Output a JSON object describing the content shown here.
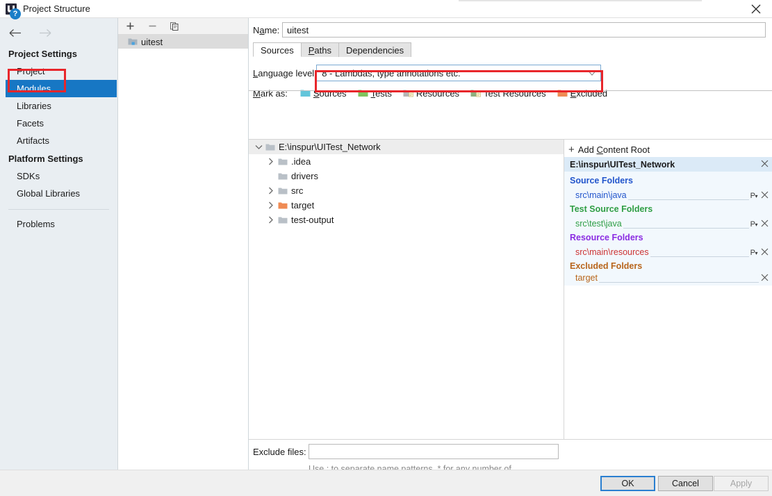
{
  "window": {
    "title": "Project Structure",
    "app_icon": "intellij-idea-icon",
    "close_label": "✕"
  },
  "sidebar": {
    "nav": {
      "back": "←",
      "forward": "→"
    },
    "groups": [
      {
        "title": "Project Settings",
        "items": [
          {
            "label": "Project",
            "selected": false
          },
          {
            "label": "Modules",
            "selected": true
          },
          {
            "label": "Libraries",
            "selected": false
          },
          {
            "label": "Facets",
            "selected": false
          },
          {
            "label": "Artifacts",
            "selected": false
          }
        ]
      },
      {
        "title": "Platform Settings",
        "items": [
          {
            "label": "SDKs",
            "selected": false
          },
          {
            "label": "Global Libraries",
            "selected": false
          }
        ]
      }
    ],
    "problems": "Problems"
  },
  "modules_panel": {
    "toolbar": [
      {
        "name": "add-module-button",
        "glyph": "+"
      },
      {
        "name": "remove-module-button",
        "glyph": "−"
      },
      {
        "name": "copy-module-button",
        "glyph": "⧉"
      }
    ],
    "items": [
      {
        "label": "uitest",
        "icon": "module-folder-icon",
        "selected": true
      }
    ]
  },
  "main": {
    "name_label": "Name:",
    "name_value": "uitest",
    "tabs": [
      {
        "label": "Sources",
        "active": true
      },
      {
        "label": "Paths",
        "active": false
      },
      {
        "label": "Dependencies",
        "active": false
      }
    ],
    "language_level_label": "Language level",
    "language_level_value": "8 - Lambdas, type annotations etc.",
    "mark_as_label": "Mark as:",
    "mark_as": [
      {
        "label": "Sources",
        "color": "#63c5da",
        "underline_index": 0
      },
      {
        "label": "Tests",
        "color": "#7fc35e",
        "underline_index": 0
      },
      {
        "label": "Resources",
        "color": "#b5b5b5",
        "underline_index": -1
      },
      {
        "label": "Test Resources",
        "color": "#8fae7f",
        "underline_index": -1
      },
      {
        "label": "Excluded",
        "color": "#ef8b54",
        "underline_index": 0
      }
    ]
  },
  "tree": {
    "root": {
      "label": "E:\\inspur\\UITest_Network",
      "expanded": true,
      "icon": "folder-icon",
      "color": "#b9c0c7"
    },
    "children": [
      {
        "label": ".idea",
        "expandable": true,
        "icon": "folder-icon",
        "color": "#b9c0c7"
      },
      {
        "label": "drivers",
        "expandable": false,
        "icon": "folder-icon",
        "color": "#b9c0c7"
      },
      {
        "label": "src",
        "expandable": true,
        "icon": "folder-icon",
        "color": "#b9c0c7"
      },
      {
        "label": "target",
        "expandable": true,
        "icon": "folder-icon",
        "color": "#ef8b54"
      },
      {
        "label": "test-output",
        "expandable": true,
        "icon": "folder-icon",
        "color": "#b9c0c7"
      }
    ]
  },
  "detail": {
    "add_content_root": "Add Content Root",
    "content_root": "E:\\inspur\\UITest_Network",
    "sections": [
      {
        "title": "Source Folders",
        "title_color": "#2255cc",
        "entries": [
          {
            "path": "src\\main\\java",
            "path_color": "#2255cc",
            "prefix_btn": "P",
            "remove": "✕"
          }
        ]
      },
      {
        "title": "Test Source Folders",
        "title_color": "#2f9e44",
        "entries": [
          {
            "path": "src\\test\\java",
            "path_color": "#2f9e44",
            "prefix_btn": "P",
            "remove": "✕"
          }
        ]
      },
      {
        "title": "Resource Folders",
        "title_color": "#8a2be2",
        "entries": [
          {
            "path": "src\\main\\resources",
            "path_color": "#cc3333",
            "prefix_btn": "P",
            "remove": "✕"
          }
        ]
      },
      {
        "title": "Excluded Folders",
        "title_color": "#b8651b",
        "entries": [
          {
            "path": "target",
            "path_color": "#b8651b",
            "prefix_btn": "",
            "remove": "✕"
          }
        ]
      }
    ]
  },
  "exclude": {
    "label": "Exclude files:",
    "value": "",
    "hint": "Use ; to separate name patterns, * for any number of symbols, ? for one."
  },
  "footer": {
    "help": "?",
    "ok": "OK",
    "cancel": "Cancel",
    "apply": "Apply"
  },
  "annotations": {
    "accent_red": "#e8262b",
    "boxes": [
      {
        "name": "modules-highlight-box"
      },
      {
        "name": "language-level-highlight-box"
      }
    ]
  }
}
